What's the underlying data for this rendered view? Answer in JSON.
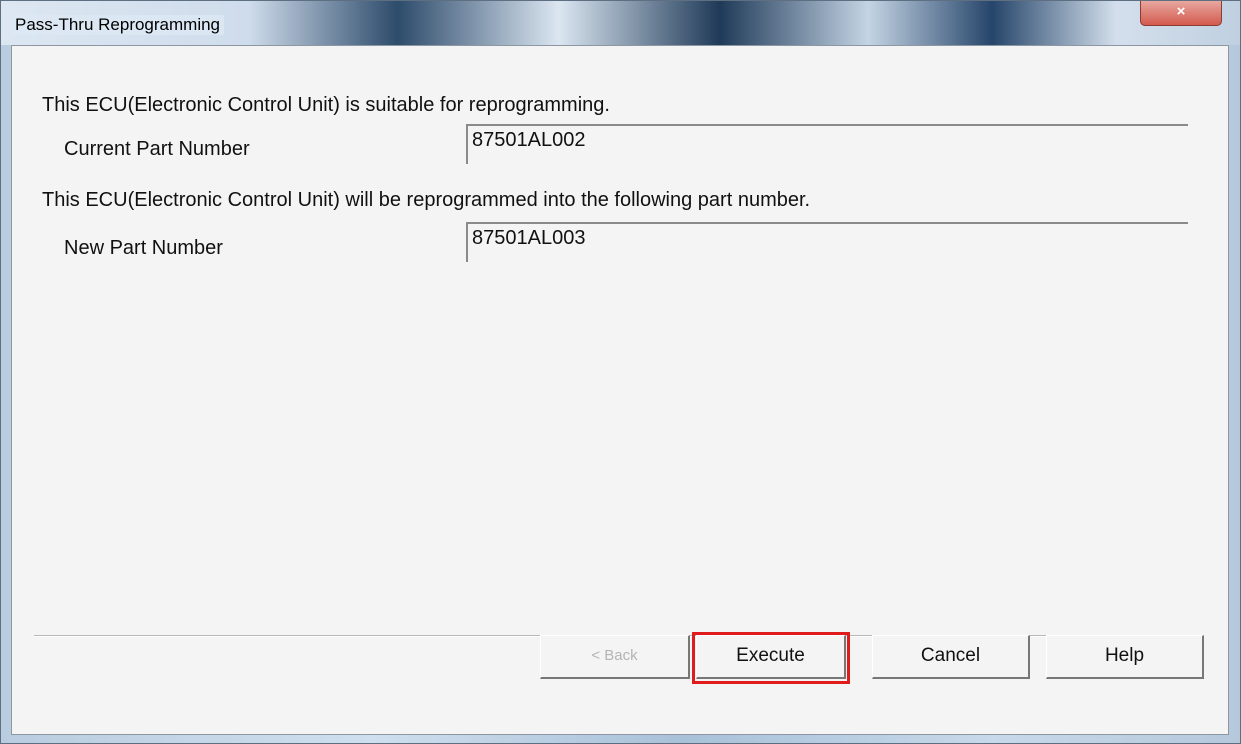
{
  "window": {
    "title": "Pass-Thru Reprogramming",
    "close_label": "×"
  },
  "content": {
    "suitable_message": "This ECU(Electronic Control Unit) is suitable for reprogramming.",
    "current_part_label": "Current Part Number",
    "current_part_value": "87501AL002",
    "reprogram_message": "This ECU(Electronic Control Unit) will be reprogrammed into the following part number.",
    "new_part_label": "New Part Number",
    "new_part_value": "87501AL003"
  },
  "buttons": {
    "back_label": "< Back",
    "execute_label": "Execute",
    "cancel_label": "Cancel",
    "help_label": "Help"
  },
  "colors": {
    "highlight": "#e01b1b",
    "client_bg": "#f4f4f4"
  }
}
